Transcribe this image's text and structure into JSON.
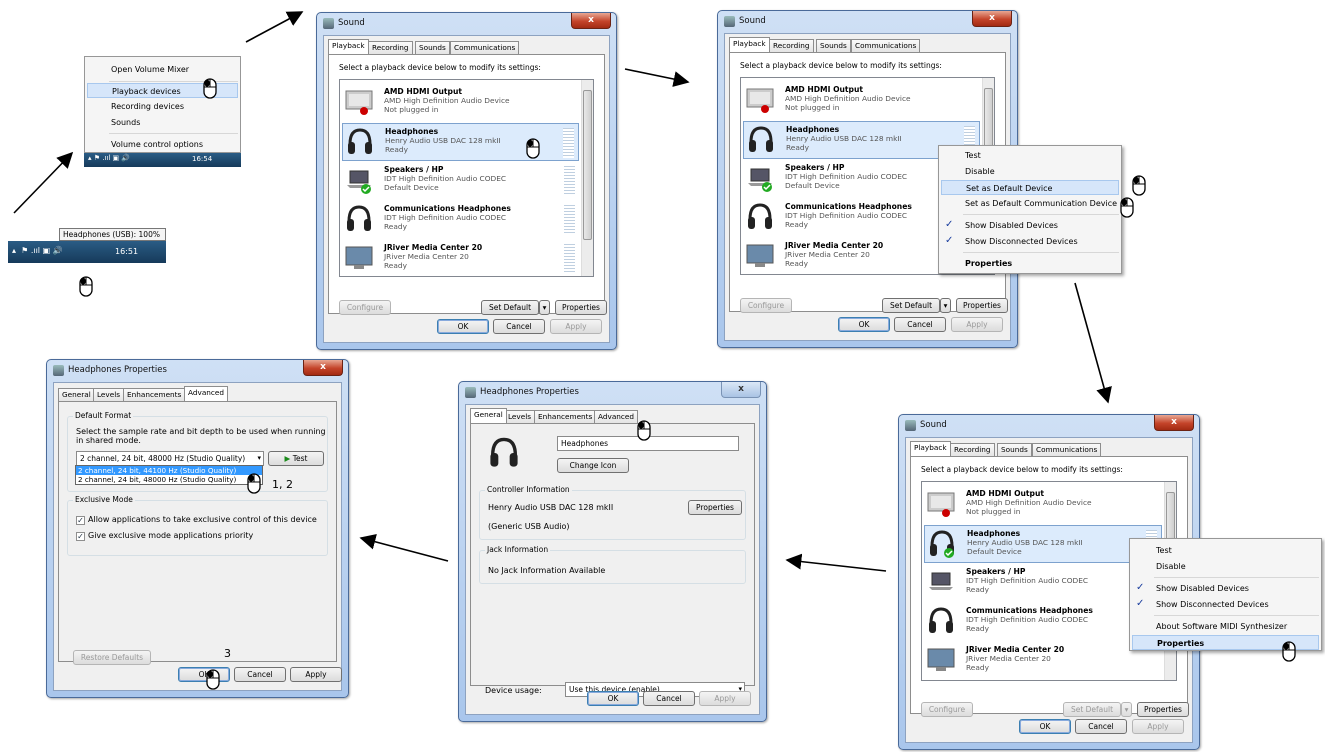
{
  "taskbar": {
    "tooltip": "Headphones (USB): 100%",
    "time": "16:51",
    "time2": "16:54"
  },
  "tray_menu": {
    "items": [
      "Open Volume Mixer",
      "Playback devices",
      "Recording devices",
      "Sounds",
      "Volume control options"
    ]
  },
  "sound": {
    "title": "Sound",
    "tabs": [
      "Playback",
      "Recording",
      "Sounds",
      "Communications"
    ],
    "instr": "Select a playback device below to modify its settings:",
    "devices": [
      {
        "name": "AMD HDMI Output",
        "desc": "AMD High Definition Audio Device",
        "status": "Not plugged in",
        "icon": "monitor-icon"
      },
      {
        "name": "Headphones",
        "desc": "Henry Audio USB DAC 128 mkII",
        "status": "Ready",
        "icon": "headphones-icon"
      },
      {
        "name": "Speakers / HP",
        "desc": "IDT High Definition Audio CODEC",
        "status": "Default Device",
        "icon": "laptop-speakers-icon"
      },
      {
        "name": "Communications Headphones",
        "desc": "IDT High Definition Audio CODEC",
        "status": "Ready",
        "icon": "headphones-icon"
      },
      {
        "name": "JRiver Media Center 20",
        "desc": "JRiver Media Center 20",
        "status": "Ready",
        "icon": "monitor-icon"
      }
    ],
    "status_default": "Default Device",
    "status_ready": "Ready",
    "configure": "Configure",
    "set_default": "Set Default",
    "properties": "Properties",
    "ok": "OK",
    "cancel": "Cancel",
    "apply": "Apply"
  },
  "ctx1": {
    "items": [
      "Test",
      "Disable",
      "Set as Default Device",
      "Set as Default Communication Device",
      "Show Disabled Devices",
      "Show Disconnected Devices",
      "Properties"
    ]
  },
  "ctx2": {
    "items": [
      "Test",
      "Disable",
      "Show Disabled Devices",
      "Show Disconnected Devices",
      "About Software MIDI Synthesizer",
      "Properties"
    ]
  },
  "hp_general": {
    "title": "Headphones Properties",
    "tabs": [
      "General",
      "Levels",
      "Enhancements",
      "Advanced"
    ],
    "name_value": "Headphones",
    "change_icon": "Change Icon",
    "controller_title": "Controller Information",
    "controller_name": "Henry Audio USB DAC 128 mkII",
    "controller_props": "Properties",
    "controller_sub": "(Generic USB Audio)",
    "jack_title": "Jack Information",
    "jack_text": "No Jack Information Available",
    "usage_label": "Device usage:",
    "usage_value": "Use this device (enable)"
  },
  "hp_adv": {
    "title": "Headphones Properties",
    "tabs": [
      "General",
      "Levels",
      "Enhancements",
      "Advanced"
    ],
    "df_title": "Default Format",
    "df_text1": "Select the sample rate and bit depth to be used when running",
    "df_text2": "in shared mode.",
    "format_value": "2 channel, 24 bit, 48000 Hz (Studio Quality)",
    "test": "Test",
    "options": [
      "2 channel, 24 bit, 44100 Hz (Studio Quality)",
      "2 channel, 24 bit, 48000 Hz (Studio Quality)"
    ],
    "ex_title": "Exclusive Mode",
    "ex1": "Allow applications to take exclusive control of this device",
    "ex2": "Give exclusive mode applications priority",
    "restore": "Restore Defaults"
  },
  "steps": {
    "s1": "1, 2",
    "s2": "3"
  }
}
